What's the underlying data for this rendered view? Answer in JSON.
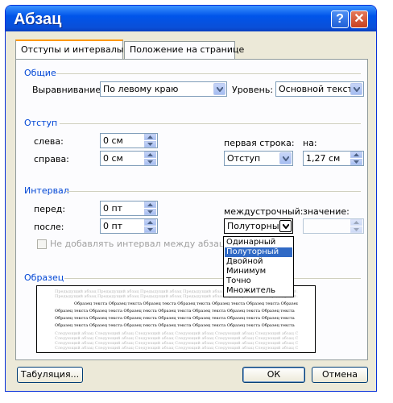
{
  "window": {
    "title": "Абзац"
  },
  "titlebar": {
    "help": "?",
    "close": "✕"
  },
  "tabs": [
    {
      "label": "Отступы и интервалы"
    },
    {
      "label": "Положение на странице"
    }
  ],
  "general": {
    "heading": "Общие",
    "alignment_label": "Выравнивание:",
    "alignment_value": "По левому краю",
    "level_label": "Уровень:",
    "level_value": "Основной текст"
  },
  "indent": {
    "heading": "Отступ",
    "left_label": "слева:",
    "left_value": "0 см",
    "right_label": "справа:",
    "right_value": "0 см",
    "first_line_label": "первая строка:",
    "first_line_value": "Отступ",
    "by_label": "на:",
    "by_value": "1,27 см"
  },
  "spacing": {
    "heading": "Интервал",
    "before_label": "перед:",
    "before_value": "0 пт",
    "after_label": "после:",
    "after_value": "0 пт",
    "line_spacing_label": "междустрочный:",
    "line_spacing_value": "Полуторный",
    "at_label": "значение:",
    "at_value": "",
    "no_space_label": "Не добавлять интервал между абзацами"
  },
  "dropdown_options": [
    "Одинарный",
    "Полуторный",
    "Двойной",
    "Минимум",
    "Точно",
    "Множитель"
  ],
  "dropdown_selected_index": 1,
  "preview": {
    "heading": "Образец",
    "prev_text": "Предыдущий абзац Предыдущий абзац Предыдущий абзац Предыдущий абзац Предыдущий абзац Предыдущий абзац Предыдущий абзац",
    "sample_text": "Образец текста Образец текста Образец текста Образец текста Образец текста Образец текста Образец текста",
    "next_text": "Следующий абзац Следующий абзац Следующий абзац Следующий абзац Следующий абзац Следующий абзац Следующий абзац"
  },
  "buttons": {
    "tabs": "Табуляция...",
    "ok": "ОК",
    "cancel": "Отмена"
  },
  "colors": {
    "titlebar": "#0a4fd8",
    "group_heading": "#0046d5",
    "highlight": "#316ac5"
  }
}
